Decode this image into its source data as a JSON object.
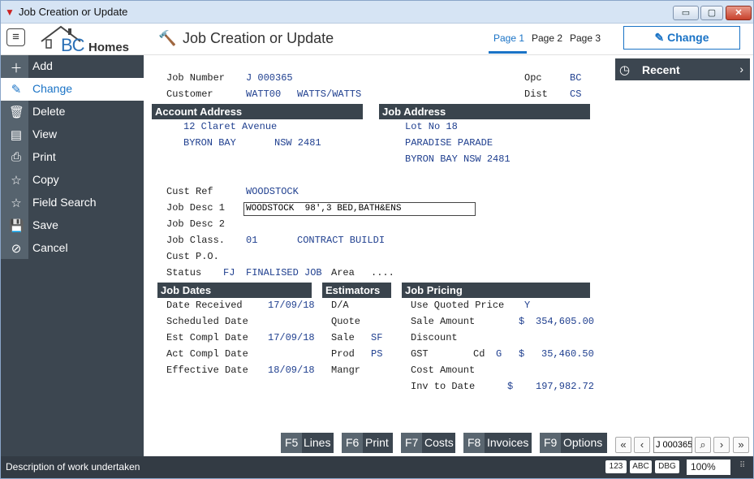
{
  "window": {
    "title": "Job Creation or Update",
    "min": "▭",
    "max": "▢",
    "close": "✕"
  },
  "header": {
    "title": "Job Creation or Update",
    "logo_bc": "BC",
    "logo_homes": "Homes",
    "tabs": [
      "Page 1",
      "Page 2",
      "Page 3"
    ],
    "change_label": "Change"
  },
  "sidebar": {
    "items": [
      {
        "label": "Add",
        "icon": "＋"
      },
      {
        "label": "Change",
        "icon": "✎"
      },
      {
        "label": "Delete",
        "icon": "🗑"
      },
      {
        "label": "View",
        "icon": "▤"
      },
      {
        "label": "Print",
        "icon": "⎙"
      },
      {
        "label": "Copy",
        "icon": "☆"
      },
      {
        "label": "Field Search",
        "icon": "☆"
      },
      {
        "label": "Save",
        "icon": "💾"
      },
      {
        "label": "Cancel",
        "icon": "⃠"
      }
    ]
  },
  "recent": {
    "label": "Recent"
  },
  "job": {
    "job_number_label": "Job Number",
    "job_number": "J 000365",
    "customer_label": "Customer",
    "customer_code": "WATT00",
    "customer_name": "WATTS/WATTS",
    "opc_label": "Opc",
    "opc": "BC",
    "dist_label": "Dist",
    "dist": "CS"
  },
  "account_address": {
    "header": "Account Address",
    "line1": "12 Claret Avenue",
    "city": "BYRON BAY",
    "state": "NSW 2481"
  },
  "job_address": {
    "header": "Job Address",
    "line1": "Lot No 18",
    "line2": "PARADISE PARADE",
    "line3": "BYRON BAY NSW 2481"
  },
  "details": {
    "cust_ref_label": "Cust Ref",
    "cust_ref": "WOODSTOCK",
    "desc1_label": "Job Desc 1",
    "desc1": "WOODSTOCK  98',3 BED,BATH&ENS",
    "desc2_label": "Job Desc 2",
    "class_label": "Job Class.",
    "class_code": "01",
    "class_name": "CONTRACT BUILDI",
    "custpo_label": "Cust P.O.",
    "status_label": "Status",
    "status_code": "FJ",
    "status_name": "FINALISED JOB",
    "area_label": "Area",
    "area": "...."
  },
  "job_dates": {
    "header": "Job Dates",
    "received_label": "Date Received",
    "received": "17/09/18",
    "scheduled_label": "Scheduled Date",
    "est_label": "Est Compl Date",
    "est": "17/09/18",
    "act_label": "Act Compl Date",
    "effective_label": "Effective Date",
    "effective": "18/09/18"
  },
  "estimators": {
    "header": "Estimators",
    "da_label": "D/A",
    "quote_label": "Quote",
    "sale_label": "Sale",
    "sale": "SF",
    "prod_label": "Prod",
    "prod": "PS",
    "mangr_label": "Mangr"
  },
  "pricing": {
    "header": "Job Pricing",
    "uqp_label": "Use Quoted Price",
    "uqp": "Y",
    "sale_amount_label": "Sale Amount",
    "sale_amount_cur": "$",
    "sale_amount": "354,605.00",
    "discount_label": "Discount",
    "gst_label": "GST",
    "cd_label": "Cd",
    "cd": "G",
    "gst_cur": "$",
    "gst": "35,460.50",
    "cost_label": "Cost Amount",
    "inv_label": "Inv to Date",
    "inv_cur": "$",
    "inv": "197,982.72"
  },
  "fkeys": [
    {
      "key": "F5",
      "label": "Lines"
    },
    {
      "key": "F6",
      "label": "Print"
    },
    {
      "key": "F7",
      "label": "Costs"
    },
    {
      "key": "F8",
      "label": "Invoices"
    },
    {
      "key": "F9",
      "label": "Options"
    }
  ],
  "nav": {
    "first": "«",
    "prev": "‹",
    "record": "J 000365",
    "search": "⌕",
    "next": "›",
    "last": "»"
  },
  "status": {
    "text": "Description of work undertaken",
    "b123": "123",
    "babc": "ABC",
    "bdbg": "DBG",
    "zoom": "100%"
  }
}
